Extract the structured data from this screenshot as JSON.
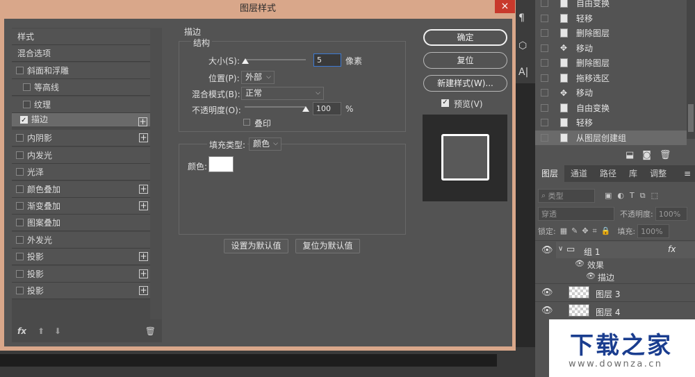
{
  "dialog": {
    "title": "图层样式",
    "close": "×"
  },
  "style_list": {
    "items": [
      {
        "label": "样式",
        "checkbox": false,
        "checked": false,
        "plus": false
      },
      {
        "label": "混合选项",
        "checkbox": false,
        "checked": false,
        "plus": false
      },
      {
        "label": "斜面和浮雕",
        "checkbox": true,
        "checked": false,
        "plus": false
      },
      {
        "label": "等高线",
        "checkbox": true,
        "checked": false,
        "plus": false,
        "indent": true
      },
      {
        "label": "纹理",
        "checkbox": true,
        "checked": false,
        "plus": false,
        "indent": true
      },
      {
        "label": "描边",
        "checkbox": true,
        "checked": true,
        "plus": true,
        "selected": true
      },
      {
        "label": "内阴影",
        "checkbox": true,
        "checked": false,
        "plus": true
      },
      {
        "label": "内发光",
        "checkbox": true,
        "checked": false,
        "plus": false
      },
      {
        "label": "光泽",
        "checkbox": true,
        "checked": false,
        "plus": false
      },
      {
        "label": "颜色叠加",
        "checkbox": true,
        "checked": false,
        "plus": true
      },
      {
        "label": "渐变叠加",
        "checkbox": true,
        "checked": false,
        "plus": true
      },
      {
        "label": "图案叠加",
        "checkbox": true,
        "checked": false,
        "plus": false
      },
      {
        "label": "外发光",
        "checkbox": true,
        "checked": false,
        "plus": false
      },
      {
        "label": "投影",
        "checkbox": true,
        "checked": false,
        "plus": true
      },
      {
        "label": "投影",
        "checkbox": true,
        "checked": false,
        "plus": true
      },
      {
        "label": "投影",
        "checkbox": true,
        "checked": false,
        "plus": true
      }
    ],
    "footer_fx": "fx"
  },
  "stroke": {
    "section_title": "描边",
    "structure_title": "结构",
    "size_label": "大小(S):",
    "size_value": "5",
    "size_unit": "像素",
    "position_label": "位置(P):",
    "position_value": "外部",
    "blend_label": "混合模式(B):",
    "blend_value": "正常",
    "opacity_label": "不透明度(O):",
    "opacity_value": "100",
    "opacity_unit": "%",
    "overprint_label": "叠印",
    "fill_type_label": "填充类型:",
    "fill_type_value": "颜色",
    "color_label": "颜色:",
    "set_default": "设置为默认值",
    "reset_default": "复位为默认值"
  },
  "buttons": {
    "ok": "确定",
    "reset": "复位",
    "new_style": "新建样式(W)...",
    "preview": "预览(V)"
  },
  "history": {
    "items": [
      {
        "label": "自由变换",
        "icon": "doc"
      },
      {
        "label": "轻移",
        "icon": "doc"
      },
      {
        "label": "删除图层",
        "icon": "doc"
      },
      {
        "label": "移动",
        "icon": "move"
      },
      {
        "label": "删除图层",
        "icon": "doc"
      },
      {
        "label": "拖移选区",
        "icon": "doc"
      },
      {
        "label": "移动",
        "icon": "move"
      },
      {
        "label": "自由变换",
        "icon": "doc"
      },
      {
        "label": "轻移",
        "icon": "doc"
      },
      {
        "label": "从图层创建组",
        "icon": "doc",
        "active": true
      }
    ]
  },
  "layers_panel": {
    "tabs": [
      "图层",
      "通道",
      "路径",
      "库",
      "调整"
    ],
    "filter_label": "类型",
    "blend_mode": "穿透",
    "opacity_label": "不透明度:",
    "opacity_value": "100%",
    "lock_label": "锁定:",
    "fill_label": "填充:",
    "fill_value": "100%",
    "layers": [
      {
        "name": "组 1",
        "kind": "group",
        "fx": "fx"
      },
      {
        "name": "效果",
        "kind": "effects"
      },
      {
        "name": "描边",
        "kind": "effect"
      },
      {
        "name": "图层 3",
        "kind": "layer"
      },
      {
        "name": "图层 4",
        "kind": "layer"
      }
    ]
  },
  "watermark": {
    "title": "下载之家",
    "url": "www.downza.cn"
  }
}
